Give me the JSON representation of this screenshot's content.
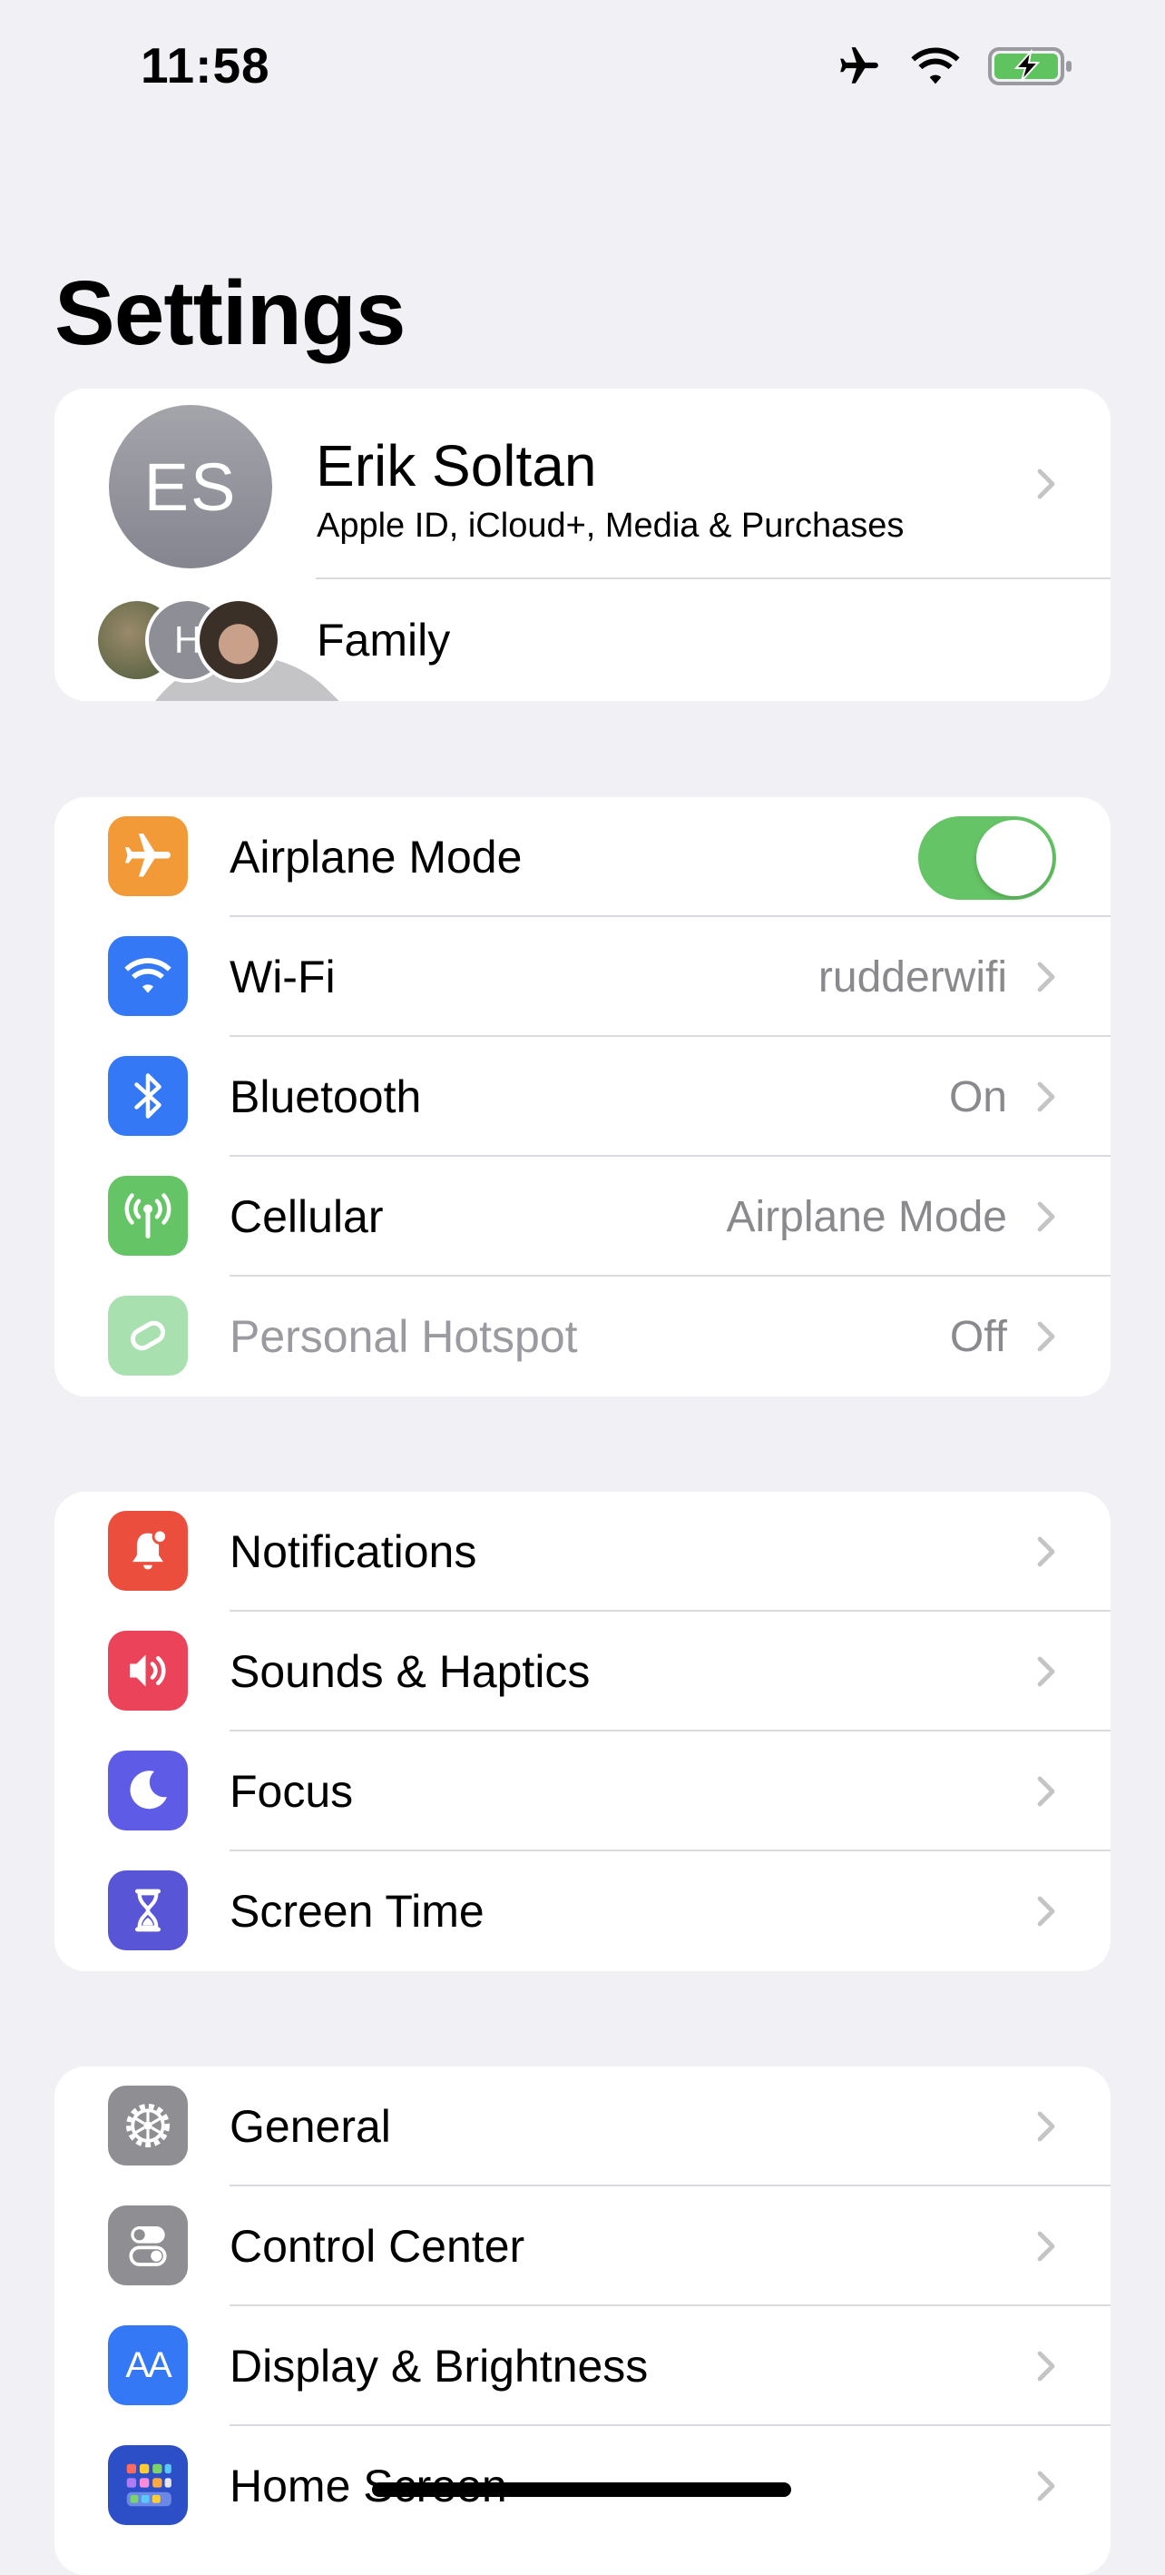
{
  "status": {
    "time": "11:58"
  },
  "page_title": "Settings",
  "profile": {
    "initials": "ES",
    "name": "Erik Soltan",
    "subtitle": "Apple ID, iCloud+, Media & Purchases",
    "family_label": "Family",
    "family_initial": "H"
  },
  "connectivity": [
    {
      "id": "airplane",
      "label": "Airplane Mode",
      "value": "",
      "toggle": true,
      "color": "#f19a37",
      "icon": "airplane-icon"
    },
    {
      "id": "wifi",
      "label": "Wi-Fi",
      "value": "rudderwifi",
      "color": "#3478f6",
      "icon": "wifi-icon"
    },
    {
      "id": "bluetooth",
      "label": "Bluetooth",
      "value": "On",
      "color": "#3478f6",
      "icon": "bluetooth-icon"
    },
    {
      "id": "cellular",
      "label": "Cellular",
      "value": "Airplane Mode",
      "color": "#65c466",
      "icon": "antenna-icon"
    },
    {
      "id": "hotspot",
      "label": "Personal Hotspot",
      "value": "Off",
      "color": "#a8e0b0",
      "icon": "hotspot-icon",
      "dim": true
    }
  ],
  "notifications_group": [
    {
      "id": "notifications",
      "label": "Notifications",
      "color": "#eb4e3d",
      "icon": "bell-icon"
    },
    {
      "id": "sounds",
      "label": "Sounds & Haptics",
      "color": "#eb445a",
      "icon": "speaker-icon"
    },
    {
      "id": "focus",
      "label": "Focus",
      "color": "#5e5ce6",
      "icon": "moon-icon"
    },
    {
      "id": "screen-time",
      "label": "Screen Time",
      "color": "#5856d6",
      "icon": "hourglass-icon"
    }
  ],
  "general_group": [
    {
      "id": "general",
      "label": "General",
      "color": "#8e8e93",
      "icon": "gear-icon"
    },
    {
      "id": "control-center",
      "label": "Control Center",
      "color": "#8e8e93",
      "icon": "switches-icon"
    },
    {
      "id": "display",
      "label": "Display & Brightness",
      "color": "#3478f6",
      "icon": "text-size-icon",
      "glyph": "AA"
    },
    {
      "id": "home-screen",
      "label": "Home Screen",
      "color": "#2c4fc7",
      "icon": "home-grid-icon"
    }
  ]
}
